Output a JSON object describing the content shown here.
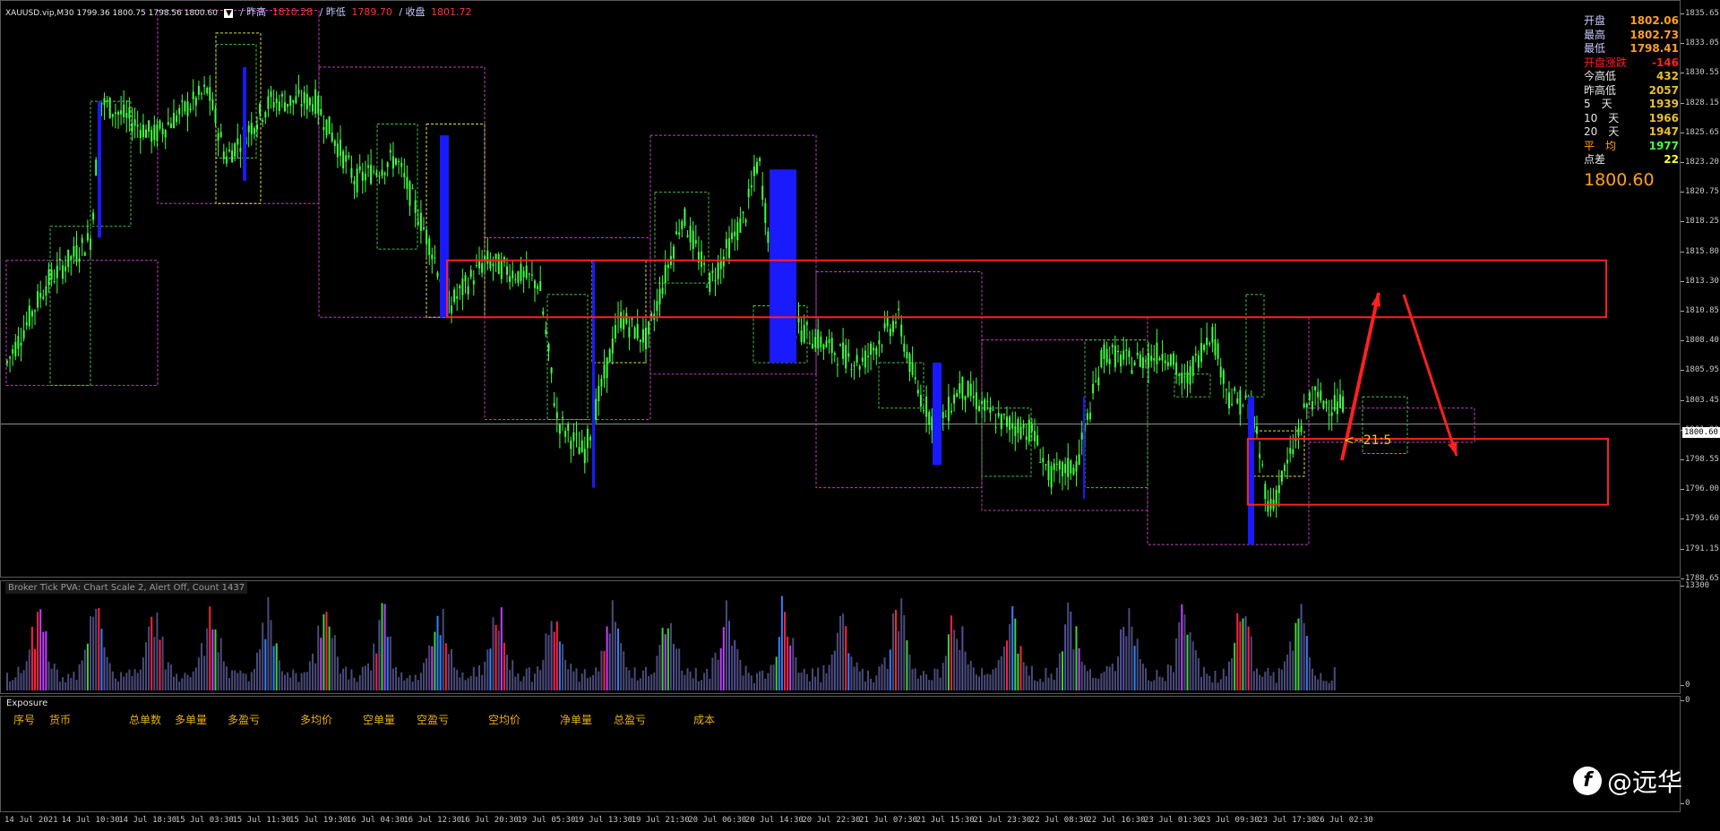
{
  "header": {
    "symbol": "XAUUSD.vip,M30  1799.36 1800.75 1798.56 1800.60",
    "prev_high_label": "/ 昨高",
    "prev_high_value": "1810.28",
    "prev_low_label": "/ 昨低",
    "prev_low_value": "1789.70",
    "close_label": "/ 收盘",
    "close_value": "1801.72"
  },
  "info_panel": {
    "rows": [
      {
        "k": "开盘",
        "v": "1802.06",
        "kc": "#c9c9ff",
        "vc": "#ffa020"
      },
      {
        "k": "最高",
        "v": "1802.73",
        "kc": "#c9c9ff",
        "vc": "#ffa020"
      },
      {
        "k": "最低",
        "v": "1798.41",
        "kc": "#c9c9ff",
        "vc": "#ffa020"
      },
      {
        "k": "开盘涨跌",
        "v": "-146",
        "kc": "#ff2020",
        "vc": "#ff2020"
      },
      {
        "k": "今高低",
        "v": "432",
        "kc": "#e6e6e6",
        "vc": "#e8c030"
      },
      {
        "k": "昨高低",
        "v": "2057",
        "kc": "#e6e6e6",
        "vc": "#e8c030"
      },
      {
        "k": "5　天",
        "v": "1939",
        "kc": "#e6e6e6",
        "vc": "#e8c030"
      },
      {
        "k": "10　天",
        "v": "1966",
        "kc": "#e6e6e6",
        "vc": "#e8c030"
      },
      {
        "k": "20　天",
        "v": "1947",
        "kc": "#e6e6e6",
        "vc": "#e8c030"
      },
      {
        "k": "平　均",
        "v": "1977",
        "kc": "#ffa020",
        "vc": "#40ff40"
      },
      {
        "k": "点差",
        "v": "22",
        "kc": "#e6e6e6",
        "vc": "#ffff30"
      }
    ],
    "current_price": "1800.60"
  },
  "price_axis": {
    "labels": [
      "1835.65",
      "1833.05",
      "1830.55",
      "1828.15",
      "1825.65",
      "1823.20",
      "1820.75",
      "1818.25",
      "1815.80",
      "1813.30",
      "1810.85",
      "1808.40",
      "1805.95",
      "1803.45",
      "1801.00",
      "1798.55",
      "1796.00",
      "1793.60",
      "1791.15",
      "1788.65"
    ],
    "current_label": "1800.60"
  },
  "annotation": {
    "label": "<--21:5"
  },
  "volume": {
    "title": "Broker Tick PVA:   Chart Scale  2,  Alert Off,  Count   1437",
    "axis_top": "13300",
    "axis_bottom": "0"
  },
  "exposure": {
    "title": "Exposure",
    "columns": [
      "序号",
      "货币",
      "总单数",
      "多单量",
      "多盈亏",
      "多均价",
      "空单量",
      "空盈亏",
      "空均价",
      "净单量",
      "总盈亏",
      "成本"
    ],
    "axis_top": "0",
    "axis_bottom": "0"
  },
  "time_axis": {
    "labels": [
      "14 Jul 2021",
      "14 Jul 10:30",
      "14 Jul 18:30",
      "15 Jul 03:30",
      "15 Jul 11:30",
      "15 Jul 19:30",
      "16 Jul 04:30",
      "16 Jul 12:30",
      "16 Jul 20:30",
      "19 Jul 05:30",
      "19 Jul 13:30",
      "19 Jul 21:30",
      "20 Jul 06:30",
      "20 Jul 14:30",
      "20 Jul 22:30",
      "21 Jul 07:30",
      "21 Jul 15:30",
      "21 Jul 23:30",
      "22 Jul 08:30",
      "22 Jul 16:30",
      "23 Jul 01:30",
      "23 Jul 09:30",
      "23 Jul 17:30",
      "26 Jul 02:30"
    ]
  },
  "watermark": {
    "logo_icon": "feather-f-icon",
    "text": "@远华"
  },
  "colors": {
    "bull": "#40ff40",
    "spike": "#1a1aff",
    "box_magenta": "#c040c0",
    "box_green": "#40c040",
    "box_yellow": "#e0e040",
    "zone_red": "#ff2020",
    "arrow_red": "#ff2020"
  }
}
